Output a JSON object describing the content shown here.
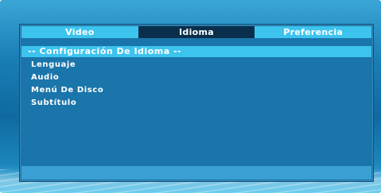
{
  "tabs": [
    {
      "label": "Video"
    },
    {
      "label": "Idioma"
    },
    {
      "label": "Preferencia"
    }
  ],
  "section_header": "-- Configuración De Idioma --",
  "menu_items": [
    {
      "label": "Lenguaje"
    },
    {
      "label": "Audio"
    },
    {
      "label": "Menú De Disco"
    },
    {
      "label": "Subtítulo"
    }
  ],
  "colors": {
    "tab_bar": "#3cc3ee",
    "active_tab": "#0a2f4d",
    "panel": "#1a75aa"
  }
}
